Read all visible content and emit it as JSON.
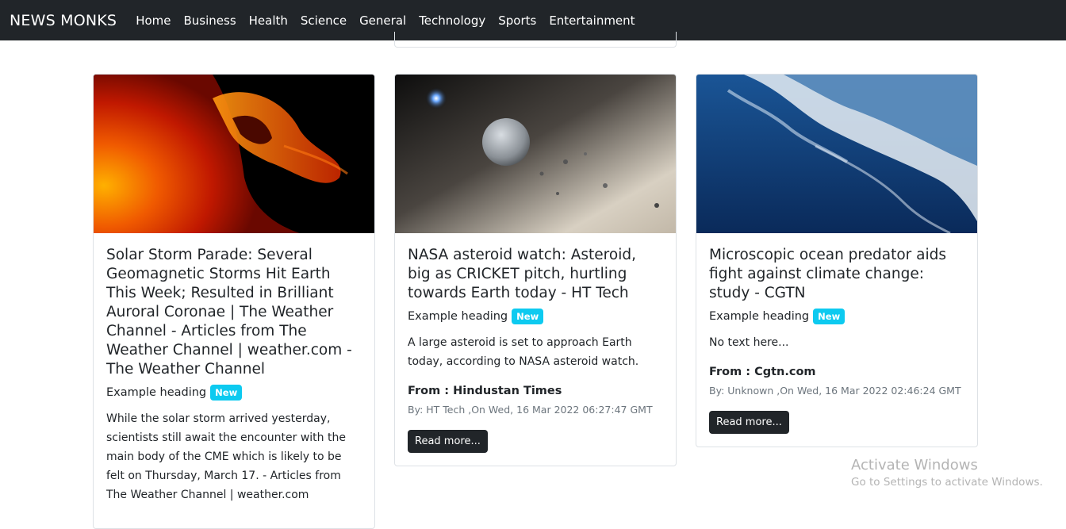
{
  "navbar": {
    "brand": "NEWS MONKS",
    "links": [
      "Home",
      "Business",
      "Health",
      "Science",
      "General",
      "Technology",
      "Sports",
      "Entertainment"
    ]
  },
  "articles": [
    {
      "title": "Solar Storm Parade: Several Geomagnetic Storms Hit Earth This Week; Resulted in Brilliant Auroral Coronae | The Weather Channel - Articles from The Weather Channel | weather.com - The Weather Channel",
      "heading": "Example heading",
      "badge": "New",
      "description": "While the solar storm arrived yesterday, scientists still await the encounter with the main body of the CME which is likely to be felt on Thursday, March 17. - Articles from The Weather Channel | weather.com",
      "image": "solar-flare",
      "image_colors": [
        "#000000",
        "#c81e00",
        "#ff6a00"
      ]
    },
    {
      "title": "NASA asteroid watch: Asteroid, big as CRICKET pitch, hurtling towards Earth today - HT Tech",
      "heading": "Example heading",
      "badge": "New",
      "description": "A large asteroid is set to approach Earth today, according to NASA asteroid watch.",
      "source": "From : Hindustan Times",
      "meta": "By: HT Tech ,On Wed, 16 Mar 2022 06:27:47 GMT",
      "button": "Read more...",
      "image": "asteroid",
      "image_colors": [
        "#1a1a1a",
        "#bdb4a8",
        "#e8e2d8"
      ]
    },
    {
      "title": "Microscopic ocean predator aids fight against climate change: study - CGTN",
      "heading": "Example heading",
      "badge": "New",
      "description": "No text here...",
      "source": "From : Cgtn.com",
      "meta": "By: Unknown ,On Wed, 16 Mar 2022 02:46:24 GMT",
      "button": "Read more...",
      "image": "ocean-wave",
      "image_colors": [
        "#0a2a5a",
        "#12488a",
        "#e8eef5"
      ]
    }
  ],
  "watermark": {
    "title": "Activate Windows",
    "subtitle": "Go to Settings to activate Windows."
  }
}
